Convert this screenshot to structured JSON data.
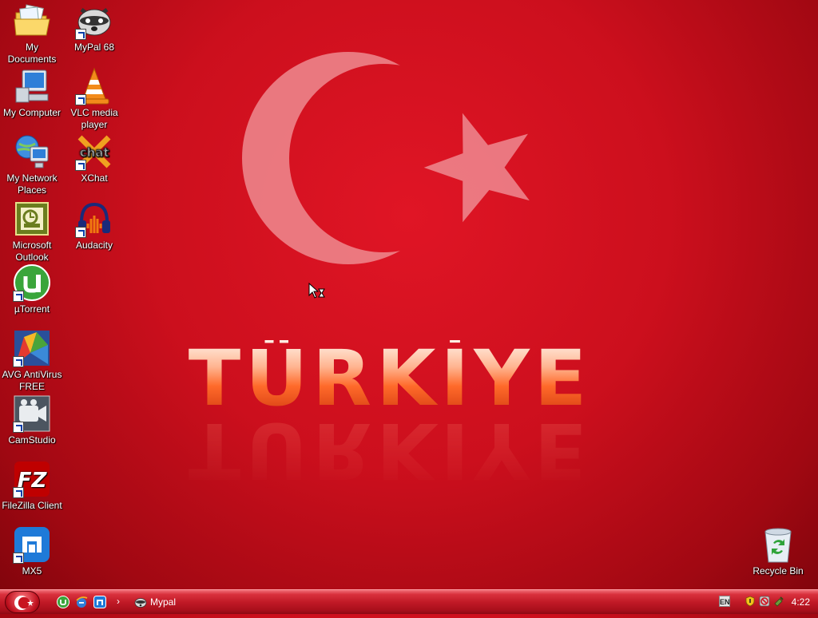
{
  "wallpaper": {
    "title": "TÜRKİYE"
  },
  "desktop_icons": [
    {
      "label": "My Documents",
      "icon": "my-documents-icon"
    },
    {
      "label": "MyPal 68",
      "icon": "mypal-raccoon-icon"
    },
    {
      "label": "My Computer",
      "icon": "my-computer-icon"
    },
    {
      "label": "VLC media player",
      "icon": "vlc-cone-icon"
    },
    {
      "label": "My Network Places",
      "icon": "network-places-icon"
    },
    {
      "label": "XChat",
      "icon": "xchat-icon"
    },
    {
      "label": "Microsoft Outlook",
      "icon": "outlook-icon"
    },
    {
      "label": "Audacity",
      "icon": "audacity-icon"
    },
    {
      "label": "µTorrent",
      "icon": "utorrent-icon"
    },
    {
      "label": "AVG AntiVirus FREE",
      "icon": "avg-icon"
    },
    {
      "label": "CamStudio",
      "icon": "camstudio-icon"
    },
    {
      "label": "FileZilla Client",
      "icon": "filezilla-icon"
    },
    {
      "label": "MX5",
      "icon": "maxthon-icon"
    },
    {
      "label": "Recycle Bin",
      "icon": "recycle-bin-icon"
    }
  ],
  "taskbar": {
    "quick_launch_more": "›",
    "task_label": "Mypal",
    "language": "EN",
    "clock": "4:22"
  },
  "colors": {
    "background": "#cc0f1d",
    "taskbar": "#c11a27"
  }
}
